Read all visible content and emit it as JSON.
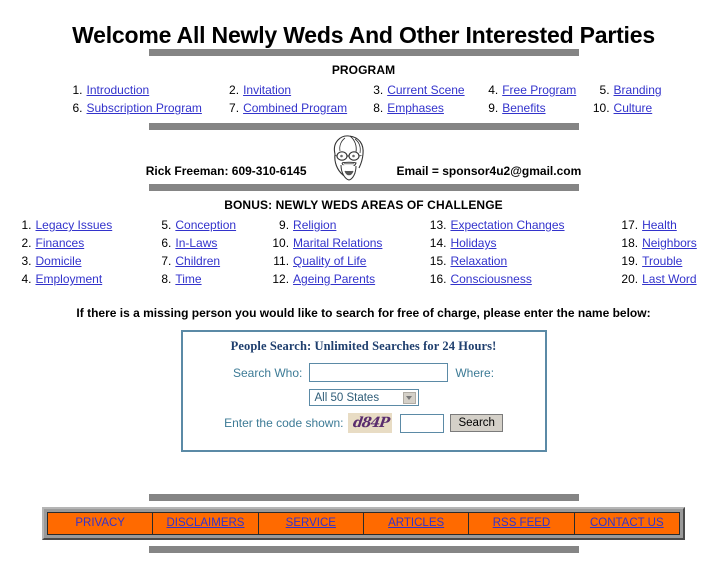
{
  "page": {
    "title": "Welcome All Newly Weds And Other Interested Parties"
  },
  "program": {
    "heading": "PROGRAM",
    "items": [
      {
        "num": "1.",
        "label": "Introduction"
      },
      {
        "num": "2.",
        "label": "Invitation"
      },
      {
        "num": "3.",
        "label": "Current Scene"
      },
      {
        "num": "4.",
        "label": "Free Program"
      },
      {
        "num": "5.",
        "label": "Branding"
      },
      {
        "num": "6.",
        "label": "Subscription Program"
      },
      {
        "num": "7.",
        "label": "Combined Program"
      },
      {
        "num": "8.",
        "label": "Emphases"
      },
      {
        "num": "9.",
        "label": "Benefits"
      },
      {
        "num": "10.",
        "label": "Culture"
      }
    ]
  },
  "contact": {
    "name_phone": "Rick Freeman: 609-310-6145",
    "email": "Email = sponsor4u2@gmail.com",
    "avatar_icon": "cartoon-face-icon"
  },
  "bonus": {
    "heading": "BONUS: NEWLY WEDS AREAS OF CHALLENGE",
    "items": [
      {
        "num": "1.",
        "label": "Legacy Issues"
      },
      {
        "num": "2.",
        "label": "Finances"
      },
      {
        "num": "3.",
        "label": "Domicile"
      },
      {
        "num": "4.",
        "label": "Employment"
      },
      {
        "num": "5.",
        "label": "Conception"
      },
      {
        "num": "6.",
        "label": "In-Laws"
      },
      {
        "num": "7.",
        "label": "Children"
      },
      {
        "num": "8.",
        "label": "Time"
      },
      {
        "num": "9.",
        "label": "Religion"
      },
      {
        "num": "10.",
        "label": "Marital Relations"
      },
      {
        "num": "11.",
        "label": "Quality of Life"
      },
      {
        "num": "12.",
        "label": "Ageing Parents"
      },
      {
        "num": "13.",
        "label": "Expectation Changes"
      },
      {
        "num": "14.",
        "label": "Holidays"
      },
      {
        "num": "15.",
        "label": "Relaxation"
      },
      {
        "num": "16.",
        "label": "Consciousness"
      },
      {
        "num": "17.",
        "label": "Health"
      },
      {
        "num": "18.",
        "label": "Neighbors"
      },
      {
        "num": "19.",
        "label": "Trouble"
      },
      {
        "num": "20.",
        "label": "Last Word"
      }
    ]
  },
  "search": {
    "prompt": "If there is a missing person you would like to search for free of charge, please enter the name below:",
    "box_title": "People Search: Unlimited Searches for 24 Hours!",
    "who_label": "Search Who:",
    "who_value": "",
    "who_placeholder": "",
    "where_label": "Where:",
    "state_selected": "All 50 States",
    "state_options": [
      "All 50 States"
    ],
    "code_label": "Enter the code shown:",
    "captcha_text": "d84P",
    "code_value": "",
    "search_button": "Search"
  },
  "footer": {
    "links": [
      {
        "label": "PRIVACY",
        "underlined": false
      },
      {
        "label": "DISCLAIMERS",
        "underlined": true
      },
      {
        "label": "SERVICE",
        "underlined": true
      },
      {
        "label": "ARTICLES",
        "underlined": true
      },
      {
        "label": "RSS FEED",
        "underlined": true
      },
      {
        "label": "CONTACT US",
        "underlined": true
      }
    ]
  },
  "colors": {
    "link": "#3333CC",
    "divider": "#858585",
    "form_border": "#5B8AA6",
    "form_label": "#3D7B96",
    "form_title": "#1F3F6E",
    "footer_cell": "#FF6A00",
    "captcha_bg": "#E8DCC4",
    "captcha_fg": "#5A2D6E"
  }
}
